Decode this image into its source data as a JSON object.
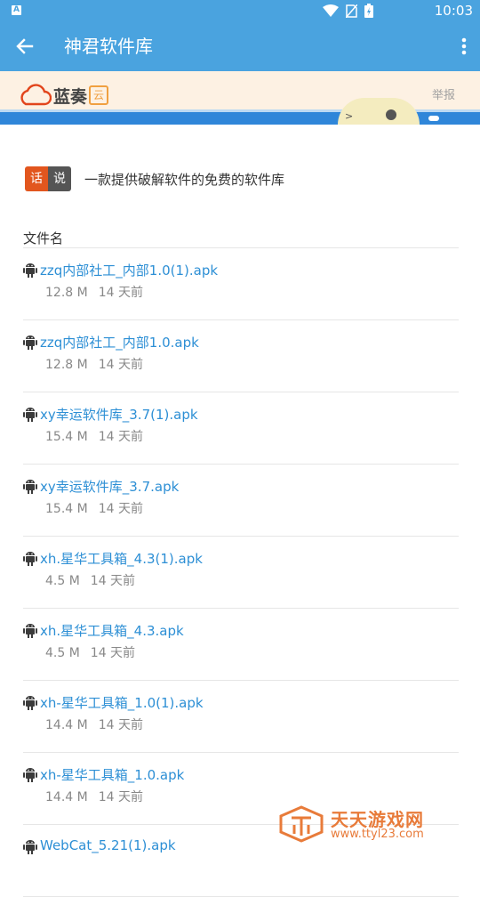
{
  "status_bar": {
    "time": "10:03"
  },
  "app_bar": {
    "title": "神君软件库"
  },
  "banner": {
    "logo_text": "蓝奏",
    "logo_badge": "云",
    "report": "举报"
  },
  "intro": {
    "tag_1": "话",
    "tag_2": "说",
    "text": "一款提供破解软件的免费的软件库"
  },
  "list": {
    "header": "文件名",
    "files": [
      {
        "name": "zzq内部社工_内部1.0(1).apk",
        "size": "12.8 M",
        "time": "14 天前"
      },
      {
        "name": "zzq内部社工_内部1.0.apk",
        "size": "12.8 M",
        "time": "14 天前"
      },
      {
        "name": "xy幸运软件库_3.7(1).apk",
        "size": "15.4 M",
        "time": "14 天前"
      },
      {
        "name": "xy幸运软件库_3.7.apk",
        "size": "15.4 M",
        "time": "14 天前"
      },
      {
        "name": "xh.星华工具箱_4.3(1).apk",
        "size": "4.5 M",
        "time": "14 天前"
      },
      {
        "name": "xh.星华工具箱_4.3.apk",
        "size": "4.5 M",
        "time": "14 天前"
      },
      {
        "name": "xh-星华工具箱_1.0(1).apk",
        "size": "14.4 M",
        "time": "14 天前"
      },
      {
        "name": "xh-星华工具箱_1.0.apk",
        "size": "14.4 M",
        "time": "14 天前"
      },
      {
        "name": "WebCat_5.21(1).apk",
        "size": "",
        "time": ""
      }
    ]
  },
  "watermark": {
    "title": "天天游戏网",
    "url": "www.ttyl23.com"
  },
  "colors": {
    "primary": "#4aa3df",
    "link": "#2d8fd5",
    "tag_orange": "#e2561e",
    "tag_gray": "#555555"
  }
}
